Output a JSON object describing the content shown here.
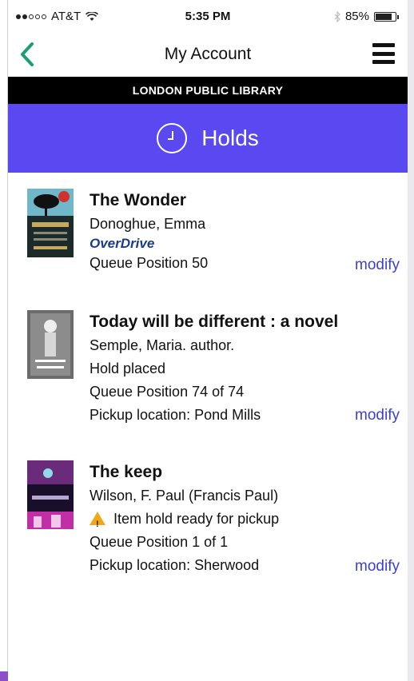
{
  "status_bar": {
    "carrier": "AT&T",
    "time": "5:35 PM",
    "battery": "85%",
    "battery_level": 0.85
  },
  "nav": {
    "back_icon": "chevron-left-icon",
    "title": "My Account",
    "menu_icon": "hamburger-menu-icon"
  },
  "library_name": "LONDON PUBLIC LIBRARY",
  "section": {
    "icon": "clock-icon",
    "title": "Holds"
  },
  "colors": {
    "accent_green": "#1a9e73",
    "section_purple": "#5a48f0",
    "link_blue": "#3b3fd6",
    "warning": "#f0a818"
  },
  "holds": [
    {
      "title": "The Wonder",
      "author": "Donoghue, Emma",
      "source": "OverDrive",
      "lines": [
        "Queue Position 50"
      ],
      "action": "modify"
    },
    {
      "title": "Today will be different : a novel",
      "author": "Semple, Maria. author.",
      "lines": [
        "Hold placed",
        "Queue Position 74 of 74",
        "Pickup location: Pond Mills"
      ],
      "action": "modify"
    },
    {
      "title": "The keep",
      "author": "Wilson, F. Paul (Francis Paul)",
      "warning": "Item hold ready for pickup",
      "lines": [
        "Queue Position 1 of 1",
        "Pickup location: Sherwood"
      ],
      "action": "modify"
    }
  ]
}
